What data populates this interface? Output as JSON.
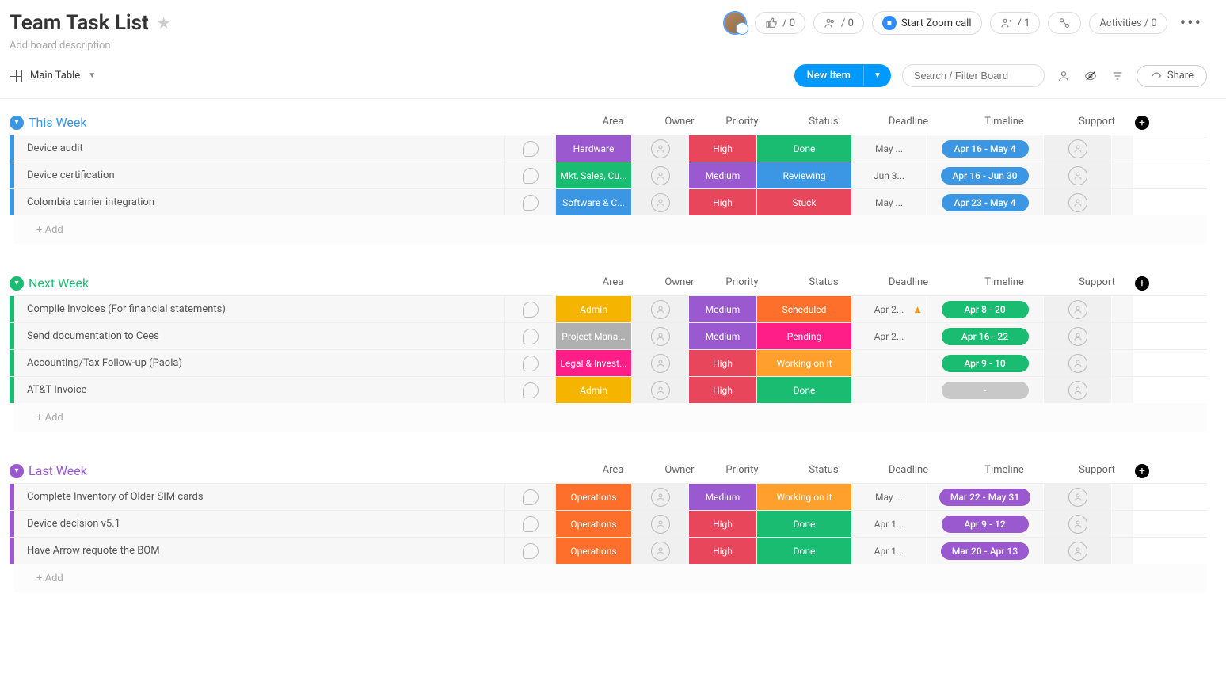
{
  "header": {
    "title": "Team Task List",
    "description_placeholder": "Add board description",
    "likes": "/ 0",
    "follows": "/ 0",
    "zoom_label": "Start Zoom call",
    "members": "/ 1",
    "integrations_icon": "integrations",
    "activities": "Activities / 0"
  },
  "toolbar": {
    "view_name": "Main Table",
    "new_item_label": "New Item",
    "search_placeholder": "Search / Filter Board",
    "share_label": "Share"
  },
  "columns": [
    "Area",
    "Owner",
    "Priority",
    "Status",
    "Deadline",
    "Timeline",
    "Support"
  ],
  "add_row_label": "+ Add",
  "colors": {
    "this_week": "#3b97e3",
    "next_week": "#1abc72",
    "last_week": "#9b59d0",
    "area": {
      "Hardware": "#9b59d0",
      "Mkt, Sales, Cu...": "#1abc72",
      "Software & C...": "#3b97e3",
      "Admin": "#f5b400",
      "Project Mana...": "#b0b0b0",
      "Legal & Invest...": "#ff1e87",
      "Operations": "#ff6f2c"
    },
    "priority": {
      "High": "#e8465a",
      "Medium": "#9b59d0"
    },
    "status": {
      "Done": "#1abc72",
      "Reviewing": "#3b97e3",
      "Stuck": "#e8465a",
      "Scheduled": "#ff6f2c",
      "Pending": "#ff1e87",
      "Working on it": "#ff9f2c"
    },
    "timeline_default": "#3b97e3",
    "timeline_empty": "#c8c8c8"
  },
  "groups": [
    {
      "name": "This Week",
      "color_key": "this_week",
      "rows": [
        {
          "title": "Device audit",
          "area": "Hardware",
          "priority": "High",
          "status": "Done",
          "deadline": "May ...",
          "timeline": "Apr 16 - May 4",
          "tl_color": "#3b97e3"
        },
        {
          "title": "Device certification",
          "area": "Mkt, Sales, Cu...",
          "priority": "Medium",
          "status": "Reviewing",
          "deadline": "Jun 3...",
          "timeline": "Apr 16 - Jun 30",
          "tl_color": "#3b97e3"
        },
        {
          "title": "Colombia carrier integration",
          "area": "Software & C...",
          "priority": "High",
          "status": "Stuck",
          "deadline": "May ...",
          "timeline": "Apr 23 - May 4",
          "tl_color": "#3b97e3"
        }
      ]
    },
    {
      "name": "Next Week",
      "color_key": "next_week",
      "rows": [
        {
          "title": "Compile Invoices (For financial statements)",
          "area": "Admin",
          "priority": "Medium",
          "status": "Scheduled",
          "deadline": "Apr 2...",
          "deadline_warn": true,
          "timeline": "Apr 8 - 20",
          "tl_color": "#1abc72"
        },
        {
          "title": "Send documentation to Cees",
          "area": "Project Mana...",
          "priority": "Medium",
          "status": "Pending",
          "deadline": "Apr 2...",
          "timeline": "Apr 16 - 22",
          "tl_color": "#1abc72"
        },
        {
          "title": "Accounting/Tax Follow-up (Paola)",
          "area": "Legal & Invest...",
          "priority": "High",
          "status": "Working on it",
          "deadline": "",
          "timeline": "Apr 9 - 10",
          "tl_color": "#1abc72"
        },
        {
          "title": "AT&T Invoice",
          "area": "Admin",
          "priority": "High",
          "status": "Done",
          "deadline": "",
          "timeline": "-",
          "tl_color": "#c8c8c8"
        }
      ]
    },
    {
      "name": "Last Week",
      "color_key": "last_week",
      "rows": [
        {
          "title": "Complete Inventory of Older SIM cards",
          "area": "Operations",
          "priority": "Medium",
          "status": "Working on it",
          "deadline": "May ...",
          "timeline": "Mar 22 - May 31",
          "tl_color": "#9b59d0"
        },
        {
          "title": "Device decision v5.1",
          "area": "Operations",
          "priority": "High",
          "status": "Done",
          "deadline": "Apr 1...",
          "timeline": "Apr 9 - 12",
          "tl_color": "#9b59d0"
        },
        {
          "title": "Have Arrow requote the BOM",
          "area": "Operations",
          "priority": "High",
          "status": "Done",
          "deadline": "Apr 1...",
          "timeline": "Mar 20 - Apr 13",
          "tl_color": "#9b59d0"
        }
      ]
    }
  ]
}
